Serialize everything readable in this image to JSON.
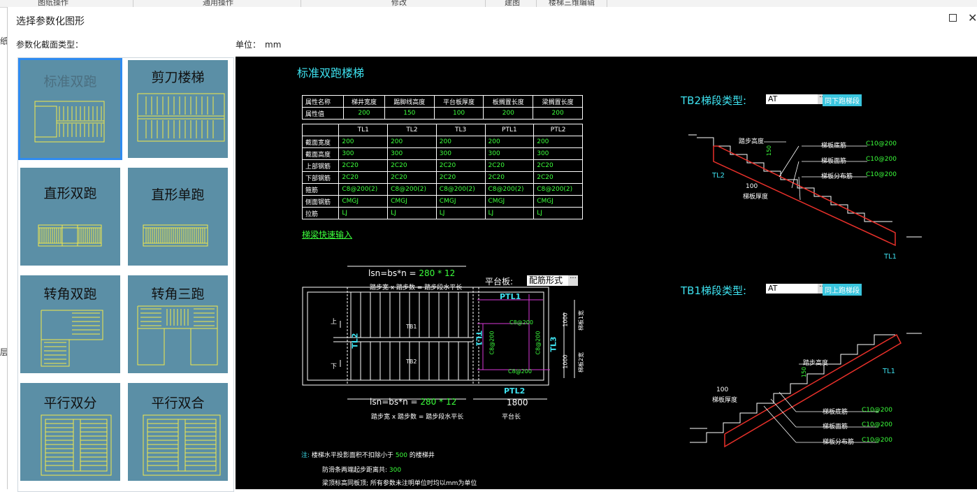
{
  "background": {
    "tabs": [
      "图纸操作",
      "通用操作",
      "修改",
      "建图",
      "楼梯三维编辑"
    ],
    "side_hints": [
      "纸",
      "层"
    ]
  },
  "dialog": {
    "title": "选择参数化图形",
    "section_label": "参数化截面类型：",
    "unit_label": "单位：",
    "unit_value": "mm"
  },
  "gallery": {
    "items": [
      {
        "label": "标准双跑",
        "selected": true
      },
      {
        "label": "剪刀楼梯"
      },
      {
        "label": "直形双跑"
      },
      {
        "label": "直形单跑"
      },
      {
        "label": "转角双跑"
      },
      {
        "label": "转角三跑"
      },
      {
        "label": "平行双分"
      },
      {
        "label": "平行双合"
      }
    ]
  },
  "cad": {
    "title": "标准双跑楼梯",
    "attr_table": {
      "headers": [
        "属性名称",
        "梯井宽度",
        "踢脚线高度",
        "平台板厚度",
        "板搁置长度",
        "梁搁置长度"
      ],
      "row_label": "属性值",
      "values": [
        "200",
        "150",
        "100",
        "200",
        "200"
      ]
    },
    "beam_table": {
      "columns": [
        "TL1",
        "TL2",
        "TL3",
        "PTL1",
        "PTL2"
      ],
      "rows": [
        {
          "label": "截面宽度",
          "values": [
            "200",
            "200",
            "200",
            "200",
            "200"
          ]
        },
        {
          "label": "截面高度",
          "values": [
            "300",
            "300",
            "300",
            "300",
            "300"
          ]
        },
        {
          "label": "上部钢筋",
          "values": [
            "2C20",
            "2C20",
            "2C20",
            "2C20",
            "2C20"
          ]
        },
        {
          "label": "下部钢筋",
          "values": [
            "2C20",
            "2C20",
            "2C20",
            "2C20",
            "2C20"
          ]
        },
        {
          "label": "箍筋",
          "values": [
            "C8@200(2)",
            "C8@200(2)",
            "C8@200(2)",
            "C8@200(2)",
            "C8@200(2)"
          ]
        },
        {
          "label": "侧面钢筋",
          "values": [
            "CMGJ",
            "CMGJ",
            "CMGJ",
            "CMGJ",
            "CMGJ"
          ]
        },
        {
          "label": "拉筋",
          "values": [
            "LJ",
            "LJ",
            "LJ",
            "LJ",
            "LJ"
          ]
        }
      ]
    },
    "quick_input_link": "梯梁快速输入",
    "plan": {
      "top_formula_prefix": "lsn=bs*n = ",
      "top_formula_value": "280 * 12",
      "top_formula_note": "踏步宽 x 踏步数 = 踏步段水平长",
      "bottom_formula_prefix": "lsn=bs*n = ",
      "bottom_formula_value": "280 * 12",
      "bottom_formula_note": "踏步宽 x 踏步数 = 踏步段水平长",
      "platform_label": "平台板:",
      "platform_value": "配筋形式",
      "platform_length": "1800",
      "platform_length_note": "平台长",
      "labels": {
        "up": "上",
        "down": "下",
        "tb1": "TB1",
        "tb2": "TB2",
        "tl2": "TL2",
        "tl1": "TL1",
        "tl3": "TL3",
        "ptl1": "PTL1",
        "ptl2": "PTL2",
        "rebar1": "C8@200",
        "rebar2": "C8@200",
        "rebar3": "C8@200",
        "rebar4": "C8@200",
        "dim1": "1000",
        "dim2": "1000",
        "w1": "梯板1宽",
        "w2": "梯板2宽"
      }
    },
    "tb2": {
      "title": "TB2梯段类型:",
      "type": "AT",
      "button": "同下跑梯段",
      "labels": {
        "step_h": "踏步高度",
        "h150": "150",
        "bottom_bar": "梯板底筋",
        "bottom_val": "C10@200",
        "top_bar": "梯板面筋",
        "top_val": "C10@200",
        "dist_bar": "梯板分布筋",
        "dist_val": "C10@200",
        "thk_val": "100",
        "thk": "梯板厚度",
        "tl2": "TL2",
        "tl1": "TL1"
      }
    },
    "tb1": {
      "title": "TB1梯段类型:",
      "type": "AT",
      "button": "同上跑梯段",
      "labels": {
        "step_h": "踏步高度",
        "h150": "150",
        "thk_val": "100",
        "thk": "梯板厚度",
        "bottom_bar": "梯板底筋",
        "bottom_val": "C10@200",
        "top_bar": "梯板面筋",
        "top_val": "C10@200",
        "dist_bar": "梯板分布筋",
        "dist_val": "C10@200",
        "tl1": "TL1"
      }
    },
    "notes": {
      "line1_prefix": "注:",
      "line1_text": "楼梯水平投影面积不扣除小于",
      "line1_value": "500",
      "line1_suffix": "的楼梯井",
      "line2_text": "防滑条两端起步距离共:",
      "line2_value": "300",
      "line3_text": "梁顶标高同板顶; 所有参数未注明单位时均以mm为单位"
    }
  },
  "colors": {
    "card_bg": "#5b8fa6",
    "card_drawing": "#f3e84a",
    "selection": "#2f8bf0",
    "cad_bg": "#000000",
    "cyan": "#3ee2f0",
    "green": "#3cff3c",
    "red": "#e8302a",
    "magenta": "#d838d8"
  }
}
